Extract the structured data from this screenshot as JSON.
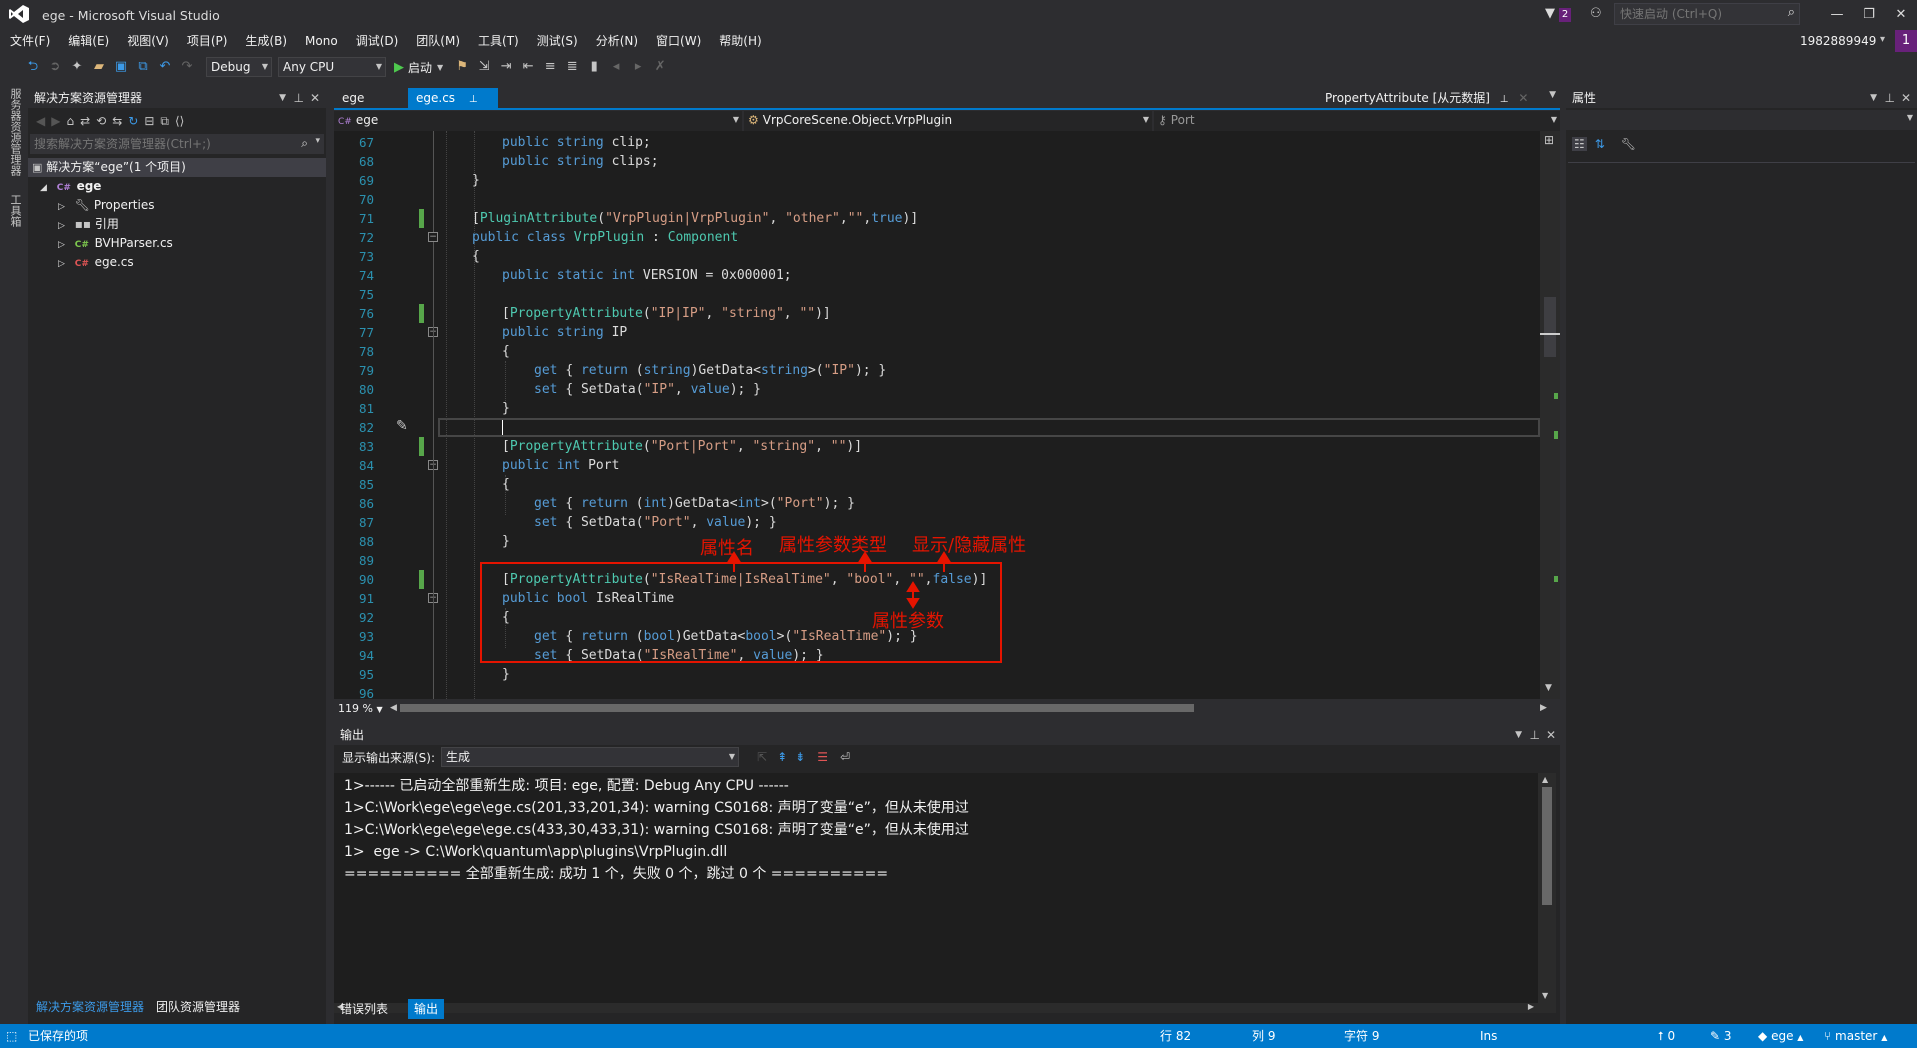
{
  "window": {
    "title": "ege - Microsoft Visual Studio",
    "notif_count": "2",
    "quick_launch_placeholder": "快速启动 (Ctrl+Q)",
    "user_id": "1982889949",
    "badge": "1"
  },
  "menu": [
    "文件(F)",
    "编辑(E)",
    "视图(V)",
    "项目(P)",
    "生成(B)",
    "Mono",
    "调试(D)",
    "团队(M)",
    "工具(T)",
    "测试(S)",
    "分析(N)",
    "窗口(W)",
    "帮助(H)"
  ],
  "toolbar": {
    "config": "Debug",
    "platform": "Any CPU",
    "start_label": "启动"
  },
  "left_strip": {
    "server_explorer": "服务器资源管理器",
    "toolbox": "工具箱"
  },
  "solution_explorer": {
    "title": "解决方案资源管理器",
    "search_placeholder": "搜索解决方案资源管理器(Ctrl+;)",
    "solution": "解决方案“ege”(1 个项目)",
    "project": "ege",
    "items": [
      "Properties",
      "引用",
      "BVHParser.cs",
      "ege.cs"
    ],
    "bottom_tabs": [
      "解决方案资源管理器",
      "团队资源管理器"
    ]
  },
  "editor": {
    "tabs": [
      {
        "label": "ege"
      },
      {
        "label": "ege.cs"
      }
    ],
    "right_tab": "PropertyAttribute [从元数据]",
    "nav_project": "ege",
    "nav_class": "VrpCoreScene.Object.VrpPlugin",
    "nav_member": "Port",
    "zoom": "119 %",
    "line_numbers": [
      "67",
      "68",
      "69",
      "70",
      "71",
      "72",
      "73",
      "74",
      "75",
      "76",
      "77",
      "78",
      "79",
      "80",
      "81",
      "82",
      "83",
      "84",
      "85",
      "86",
      "87",
      "88",
      "89",
      "90",
      "91",
      "92",
      "93",
      "94",
      "95",
      "96"
    ],
    "annotations": {
      "attr_name": "属性名",
      "attr_param_type": "属性参数类型",
      "show_hide": "显示/隐藏属性",
      "attr_param": "属性参数"
    }
  },
  "output": {
    "title": "输出",
    "source_label": "显示输出来源(S):",
    "source_value": "生成",
    "lines": [
      "1>------ 已启动全部重新生成: 项目: ege, 配置: Debug Any CPU ------",
      "1>C:\\Work\\ege\\ege\\ege.cs(201,33,201,34): warning CS0168: 声明了变量“e”，但从未使用过",
      "1>C:\\Work\\ege\\ege\\ege.cs(433,30,433,31): warning CS0168: 声明了变量“e”，但从未使用过",
      "1>  ege -> C:\\Work\\quantum\\app\\plugins\\VrpPlugin.dll",
      "========== 全部重新生成: 成功 1 个，失败 0 个，跳过 0 个 =========="
    ],
    "bottom_tabs": [
      "错误列表",
      "输出"
    ]
  },
  "properties": {
    "title": "属性"
  },
  "status": {
    "message": "已保存的项",
    "line": "行 82",
    "col": "列 9",
    "char": "字符 9",
    "mode": "Ins",
    "up_count": "0",
    "edit_count": "3",
    "repo": "ege",
    "branch": "master"
  },
  "colors": {
    "accent": "#007acc",
    "annotation": "#e51400",
    "keyword": "#569cd6",
    "type": "#4ec9b0",
    "string": "#d69d85"
  }
}
